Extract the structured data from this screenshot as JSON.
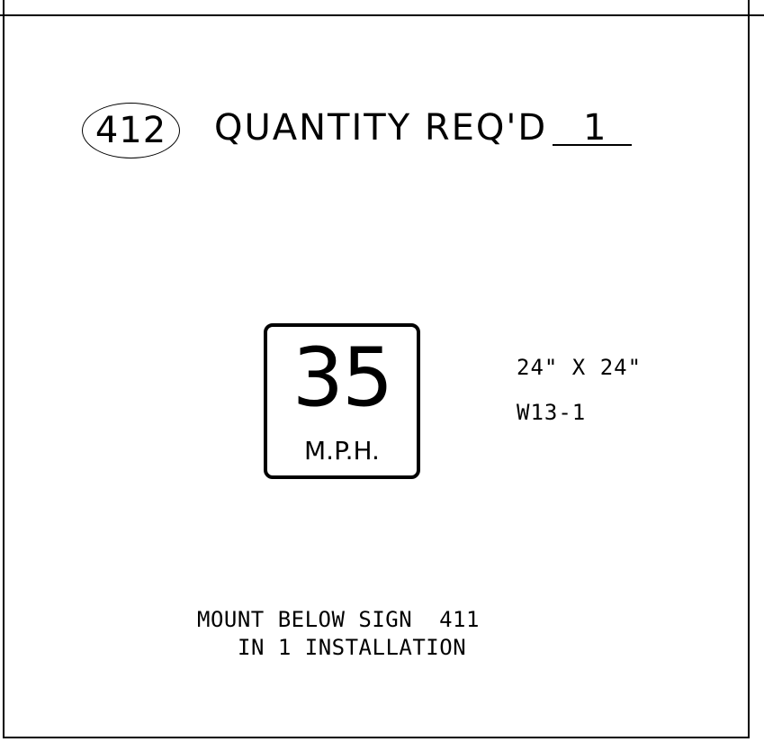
{
  "sheet": {
    "sign_number": "412",
    "quantity_label": "QUANTITY REQ'D",
    "quantity_value": "1"
  },
  "sign": {
    "speed_value": "35",
    "speed_unit": "M.P.H.",
    "size": "24\" X 24\"",
    "code": "W13-1"
  },
  "notes": {
    "line1": "MOUNT BELOW SIGN  411",
    "line2": "IN 1 INSTALLATION"
  }
}
